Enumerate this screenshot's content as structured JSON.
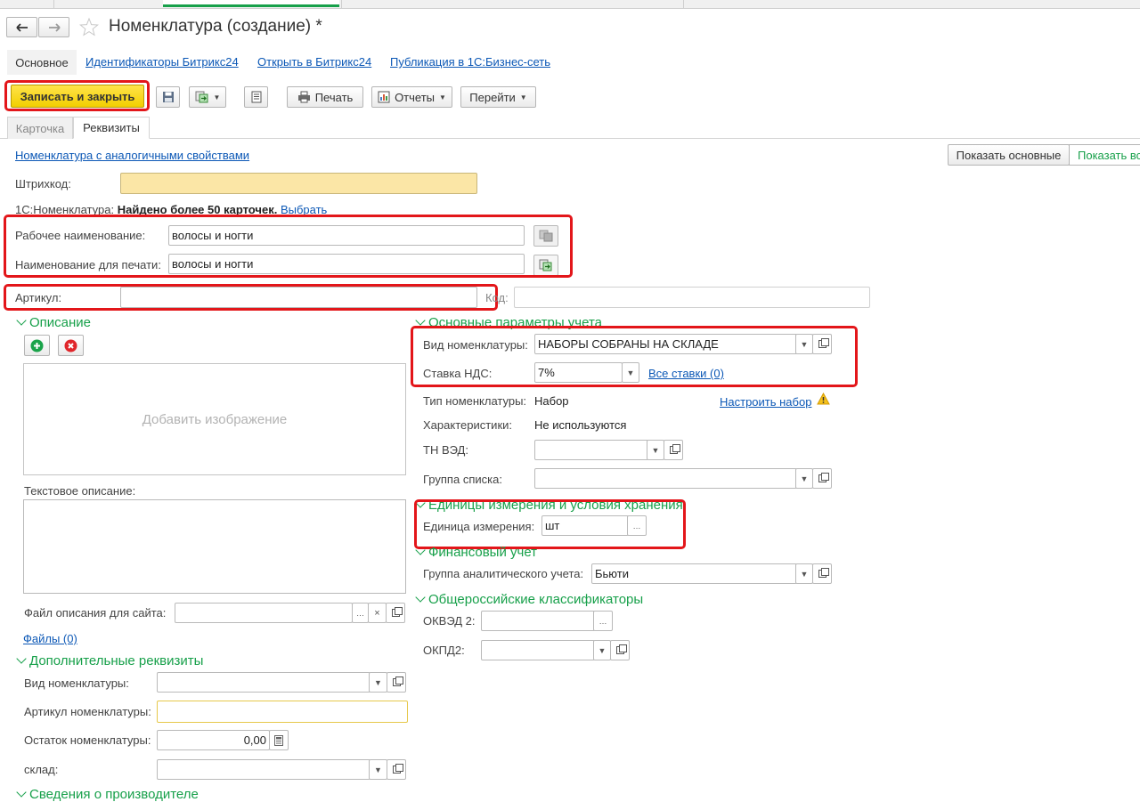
{
  "window": {
    "title": "Номенклатура (создание) *",
    "star_icon": "star-icon",
    "back_icon": "arrow-left-icon",
    "forward_icon": "arrow-right-icon"
  },
  "nav": {
    "main_label": "Основное",
    "links": [
      "Идентификаторы Битрикс24",
      "Открыть в Битрикс24",
      "Публикация в 1С:Бизнес-сеть"
    ]
  },
  "toolbar": {
    "save_close": "Записать и закрыть",
    "print": "Печать",
    "reports": "Отчеты",
    "goto": "Перейти"
  },
  "tabs": [
    {
      "label": "Карточка",
      "active": false
    },
    {
      "label": "Реквизиты",
      "active": true
    }
  ],
  "top_right": {
    "show_main": "Показать основные",
    "show_all": "Показать все"
  },
  "analog_link": "Номенклатура с аналогичными свойствами",
  "barcode": {
    "label": "Штрихкод:",
    "value": ""
  },
  "nomenclature_1c": {
    "label": "1С:Номенклатура:",
    "found": "Найдено более 50 карточек.",
    "choose": "Выбрать"
  },
  "work_name": {
    "label": "Рабочее наименование:",
    "value": "волосы и ногти"
  },
  "print_name": {
    "label": "Наименование для печати:",
    "value": "волосы и ногти"
  },
  "article": {
    "label": "Артикул:",
    "value": ""
  },
  "code": {
    "label": "Код:",
    "value": ""
  },
  "description": {
    "title": "Описание",
    "add_image": "Добавить изображение",
    "text_label": "Текстовое описание:",
    "file_label": "Файл описания для сайта:",
    "files_link": "Файлы (0)"
  },
  "extra": {
    "title": "Дополнительные реквизиты",
    "kind_label": "Вид номенклатуры:",
    "article_label": "Артикул номенклатуры:",
    "rest_label": "Остаток номенклатуры:",
    "rest_value": "0,00",
    "warehouse_label": "склад:"
  },
  "manufacturer": {
    "title": "Сведения о производителе"
  },
  "params": {
    "title": "Основные параметры учета",
    "kind_label": "Вид номенклатуры:",
    "kind_value": "НАБОРЫ СОБРАНЫ НА СКЛАДЕ",
    "vat_label": "Ставка НДС:",
    "vat_value": "7%",
    "all_rates": "Все ставки (0)",
    "type_label": "Тип номенклатуры:",
    "type_value": "Набор",
    "configure": "Настроить набор",
    "char_label": "Характеристики:",
    "char_value": "Не используются",
    "tnved_label": "ТН ВЭД:",
    "group_label": "Группа списка:"
  },
  "units": {
    "title": "Единицы измерения и условия хранения",
    "unit_label": "Единица измерения:",
    "unit_value": "шт"
  },
  "finance": {
    "title": "Финансовый учет",
    "group_label": "Группа аналитического учета:",
    "group_value": "Бьюти"
  },
  "classifiers": {
    "title": "Общероссийские классификаторы",
    "okved_label": "ОКВЭД 2:",
    "okpd_label": "ОКПД2:"
  },
  "colors": {
    "accent_green": "#17a04a",
    "save_button": "#f5d400",
    "highlight_red": "#e3161a",
    "link_blue": "#0c58b6"
  }
}
